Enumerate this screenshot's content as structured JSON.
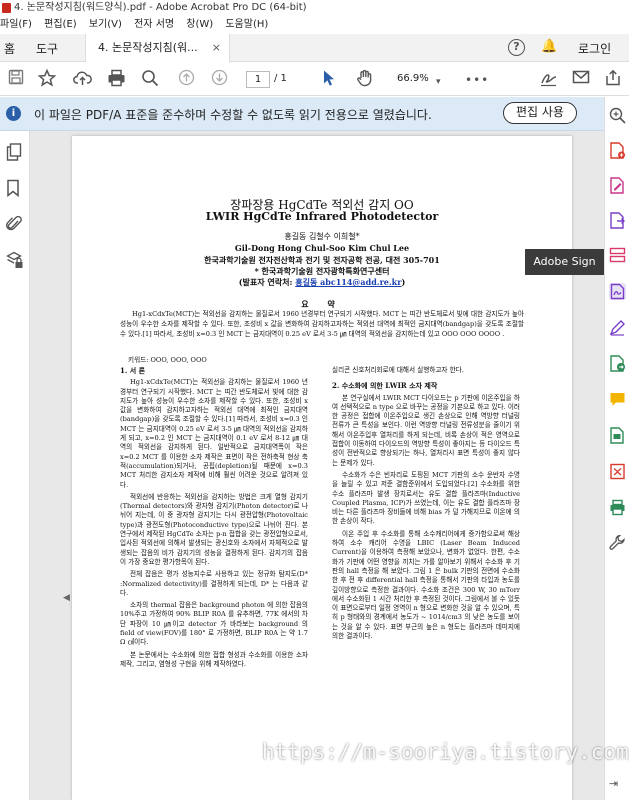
{
  "window": {
    "title": "4. 논문작성지침(워드양식).pdf - Adobe Acrobat Pro DC (64-bit)"
  },
  "menu": [
    "파일(F)",
    "편집(E)",
    "보기(V)",
    "전자 서명",
    "창(W)",
    "도움말(H)"
  ],
  "tabs": {
    "home": "홈",
    "tools": "도구",
    "document": "4. 논문작성지침(워...",
    "close": "×"
  },
  "header": {
    "help": "?",
    "login": "로그인"
  },
  "toolbar": {
    "page_current": "1",
    "page_total": "/ 1",
    "zoom": "66.9%",
    "more": "•••"
  },
  "notice": {
    "message": "이 파일은 PDF/A 표준을 준수하며 수정할 수 없도록 읽기 전용으로 열렸습니다.",
    "button": "편집 사용"
  },
  "tooltip": {
    "label": "Adobe Sign"
  },
  "accent": "#2a5fa8",
  "document": {
    "title_ko": "장파장용 HgCdTe 적외선 감지 OO",
    "title_en": "LWIR HgCdTe Infrared Photodetector",
    "authors_ko": "홍길동   김철수 이희철*",
    "authors_en": "Gil-Dong Hong    Chul-Soo Kim    Chul Lee",
    "affil_1": "한국과학기술원 전자전산학과 전기 및 전자공학 전공, 대전 305-701",
    "affil_2": "* 한국과학기술원 전자광학특화연구센터",
    "affil_3_prefix": "(발표자 연락처: ",
    "affil_3_link": "홍길동 abc114@add.re.kr",
    "affil_3_suffix": ")",
    "abstract_head": "요 약",
    "abstract": "Hg1-xCdxTe(MCT)는 적외선을 감지하는 물질로서 1960 년경부터 연구되기 시작했다. MCT 는 띠간 반도체로서 빛에 대한 감지도가 높아 성능이 우수한 소자를 제작할 수 있다. 또한, 조성비 x 값을 변화하여 감지하고자하는 적외선 대역에 최적인 금지대역(bandgap)을 갖도록 조절할 수 있다.[1] 따라서, 조성비 x=0.3 인 MCT 는 금지대역이 0.25 eV 로서 3-5 ㎛ 대역의 적외선을 감지하는데 있고 OOO OOO OOOO .",
    "keywords": "키워드: OOO, OOO, OOO",
    "left_column": [
      {
        "heading": "1. 서 론"
      },
      {
        "para": "Hg1-xCdxTe(MCT)는 적외선을 감지하는 물질로서 1960 년경부터 연구되기 시작했다. MCT 는 띠간 반도체로서 빛에 대한 감지도가 높아 성능이 우수한 소자를 제작할 수 있다. 또한, 조성비 x 값을 변화하여 감지하고자하는 적외선 대역에 최적인 금지대역(bandgap)을 갖도록 조절할 수 있다.[1] 따라서, 조성비 x=0.3 인 MCT 는 금지대역이 0.25 eV 로서 3-5 ㎛ 대역의 적외선을 감지하게 되고, x=0.2 인 MCT 는 금지대역이 0.1 eV 로서 8-12 ㎛ 대역의 적외선을 감지하게 된다. 일반적으로 금지대역폭이 작은 x=0.2 MCT 를 이용한 소자 제작은 표면이 작은 전하축적 현상 축적(accumulation)되거나, 공핍(depletion)될 때문에 x=0.3 MCT 처리한 감지소자 제작에 비해 훨씬 어려운 것으로 알려져 있다."
      },
      {
        "para": "적외선에 반응하는 적외선을 감지하는 방법은 크게 열형 감지기(Thermal detectors)와 광자형 감지기(Photon detector)로 나뉘어 지는데, 이 중 광자형 감지기는 다시 광전압형(Photovoltaic type)과 광전도형(Photoconductive type)으로 나뉘어 진다. 본 연구에서 제작된 HgCdTe 소자는 p-n 접합을 갖는 광전압형으로서, 입사된 적외선에 의해서 발생되는 광신호와 소자에서 자체적으로 발생되는 잡음의 비가 감지기의 성능을 결정하게 된다. 감지기의 잡음이 가장 중요한 평가항목이 된다."
      },
      {
        "para": "전체 잡음은 평가 성능지수로 사용하고 있는 정규화 탐지도(D* :Normalized detectivity)를 결정하게 되는데, D* 는 다음과 같다."
      },
      {
        "para": "소자의 thermal 잡음은 background photon 에 의한 잡음의 10%주고 가정하여 90% BLIP R0A 를 유추하면, 77K 에서의 차단 파장이 10 ㎛이고 detector 가 바라보는 background 의 field of view(FOV)를 180° 로 가정하면, BLIP R0A 는 약 1.7 Ω ㎠이다."
      },
      {
        "para": "본 논문에서는 수소화에 의한 접합 형성과 수소화를 이용한 소자제작, 그리고, 염형성 구현을 위해 제작하였다."
      }
    ],
    "right_column": [
      {
        "para": "실리콘 신호처리회로에 대해서 실행하고자 한다."
      },
      {
        "heading": "2. 수소화에 의한 LWIR 소자 제작"
      },
      {
        "para": "본 연구실에서 LWIR MCT 다이오드는 p 기판에 이온주입을 하여 선택적으로 n type 으로 바꾸는 공정을 기본으로 하고 있다. 이러한 공정은 접합에 이온주입으로 생긴 손상으로 인해 역방향 터널링 전류가 큰 특성을 보인다. 이런 역방향 터널링 전류성분을 줄이기 위해서 이온주입후 열처리를 하게 되는데, 비록 손상이 적은 영역으로 접합이 이동하여 다이오드의 역방향 특성이 좋아지는 등 다이오드 특성이 전반적으로 향상되기는 하나, 열처리시 표면 특성이 좋지 않다는 문제가 있다."
      },
      {
        "para": "수소화가 수은 빈자리로 도핑된 MCT 기판의 소수 운반자 수명을 늘릴 수 있고 저준 결함준위에서 도입되었다.[2] 수소화를 위한 수소 플라즈마 발생 장치로서는 유도 결합 플라즈마(Inductive Coupled Plasma, ICP)가 쓰였는데, 이는 유도 결합 플라즈마 장비는 다른 플라즈마 장비들에 비해 bias 가 덜 가해지므로 이온에 의한 손상이 작다."
      },
      {
        "para": "이온 주입 후 수소화를 통해 소수캐리어에게 증가함으로써 해상하여 소수 캐리어 수명을 LBIC (Laser Beam Induced Current)을 이용하여 측정해 보았으나, 변화가 없었다. 한편, 수소화가 기판에 어떤 영향을 끼치는 가를 알아보기 위해서 수소화 후 기판의 hall 측정을 해 보았다. 그림 1 은 bulk 기판의 전면에 수소화한 후 전 후 differential hall 측정을 통해서 기판의 타입과 농도를 깊이방향으로 측정한 결과이다. 수소화 조건은 300 W, 30 mTorr 에서 수소화된 1 시간 처리한 후 측정된 것이다. 그림에서 볼 수 있듯이 표면으로부터 일정 영역이 n 형으로 변화한 것을 알 수 있으며, 특히 p 형태와의 경계에서 농도가 ~ 1014/cm3 의 낮은 농도를 보이는 것을 알 수 있다. 표면 부근의 높은 n 형도는 플라즈마 데미지에 의한 결과이다."
      }
    ]
  },
  "watermark": "https://m-sooriya.tistory.com/"
}
